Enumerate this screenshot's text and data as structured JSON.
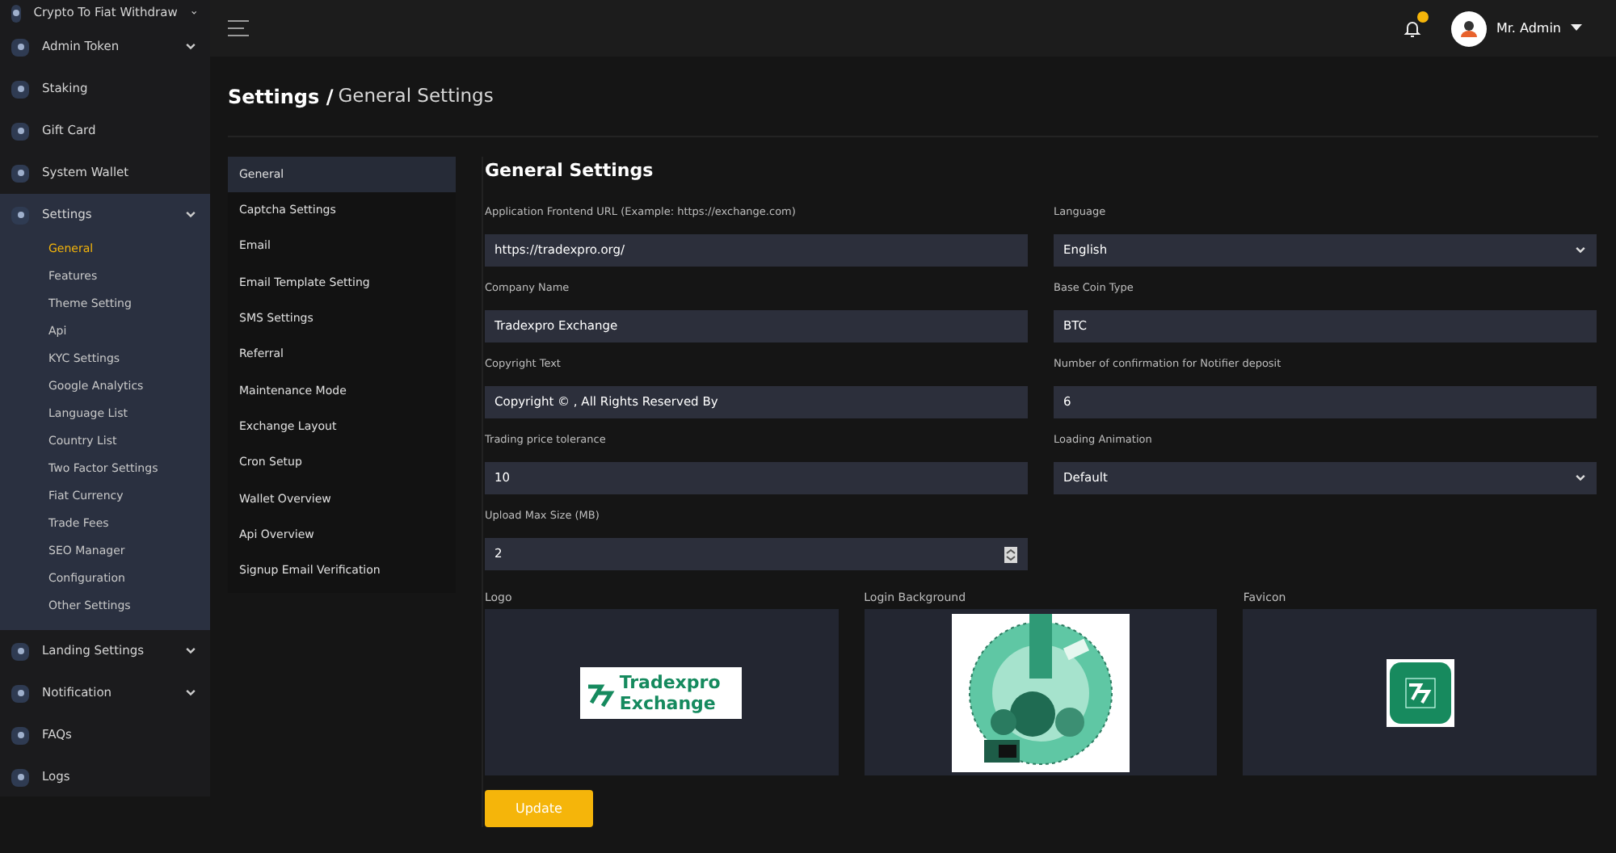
{
  "sidebar": {
    "items": [
      {
        "label": "Crypto To Fiat Withdraw",
        "kind": "group"
      },
      {
        "label": "Admin Token",
        "kind": "group"
      },
      {
        "label": "Staking",
        "kind": "link"
      },
      {
        "label": "Gift Card",
        "kind": "link"
      },
      {
        "label": "System Wallet",
        "kind": "link"
      },
      {
        "label": "Settings",
        "kind": "group",
        "expanded": true,
        "children": [
          {
            "label": "General",
            "selected": true
          },
          {
            "label": "Features",
            "selected": false
          },
          {
            "label": "Theme Setting",
            "selected": false
          },
          {
            "label": "Api",
            "selected": false
          },
          {
            "label": "KYC Settings",
            "selected": false
          },
          {
            "label": "Google Analytics",
            "selected": false
          },
          {
            "label": "Language List",
            "selected": false
          },
          {
            "label": "Country List",
            "selected": false
          },
          {
            "label": "Two Factor Settings",
            "selected": false
          },
          {
            "label": "Fiat Currency",
            "selected": false
          },
          {
            "label": "Trade Fees",
            "selected": false
          },
          {
            "label": "SEO Manager",
            "selected": false
          },
          {
            "label": "Configuration",
            "selected": false
          },
          {
            "label": "Other Settings",
            "selected": false
          }
        ]
      },
      {
        "label": "Landing Settings",
        "kind": "group"
      },
      {
        "label": "Notification",
        "kind": "group"
      },
      {
        "label": "FAQs",
        "kind": "link"
      },
      {
        "label": "Logs",
        "kind": "link"
      }
    ]
  },
  "header": {
    "user_name": "Mr. Admin",
    "notification_badge": true
  },
  "breadcrumb": {
    "parent": "Settings /",
    "current": "General Settings"
  },
  "settings_menu": [
    {
      "label": "General",
      "selected": true
    },
    {
      "label": "Captcha Settings",
      "selected": false
    },
    {
      "label": "Email",
      "selected": false
    },
    {
      "label": "Email Template Setting",
      "selected": false
    },
    {
      "label": "SMS Settings",
      "selected": false
    },
    {
      "label": "Referral",
      "selected": false
    },
    {
      "label": "Maintenance Mode",
      "selected": false
    },
    {
      "label": "Exchange Layout",
      "selected": false
    },
    {
      "label": "Cron Setup",
      "selected": false
    },
    {
      "label": "Wallet Overview",
      "selected": false
    },
    {
      "label": "Api Overview",
      "selected": false
    },
    {
      "label": "Signup Email Verification",
      "selected": false
    }
  ],
  "form": {
    "title": "General Settings",
    "fields": [
      {
        "label": "Application Frontend URL (Example: https://exchange.com)",
        "value": "https://tradexpro.org/",
        "kind": "text"
      },
      {
        "label": "Language",
        "value": "English",
        "kind": "select"
      },
      {
        "label": "Company Name",
        "value": "Tradexpro Exchange",
        "kind": "text"
      },
      {
        "label": "Base Coin Type",
        "value": "BTC",
        "kind": "text"
      },
      {
        "label": "Copyright Text",
        "value": "Copyright © , All Rights Reserved By",
        "kind": "text"
      },
      {
        "label": "Number of confirmation for Notifier deposit",
        "value": "6",
        "kind": "text"
      },
      {
        "label": "Trading price tolerance",
        "value": "10",
        "kind": "text"
      },
      {
        "label": "Loading Animation",
        "value": "Default",
        "kind": "select"
      },
      {
        "label": "Upload Max Size (MB)",
        "value": "2",
        "kind": "number"
      }
    ],
    "images": [
      {
        "label": "Logo",
        "kind": "logo",
        "logo_text": [
          "Tradexpro",
          "Exchange"
        ]
      },
      {
        "label": "Login Background",
        "kind": "picture"
      },
      {
        "label": "Favicon",
        "kind": "favicon"
      }
    ],
    "submit": "Update"
  }
}
